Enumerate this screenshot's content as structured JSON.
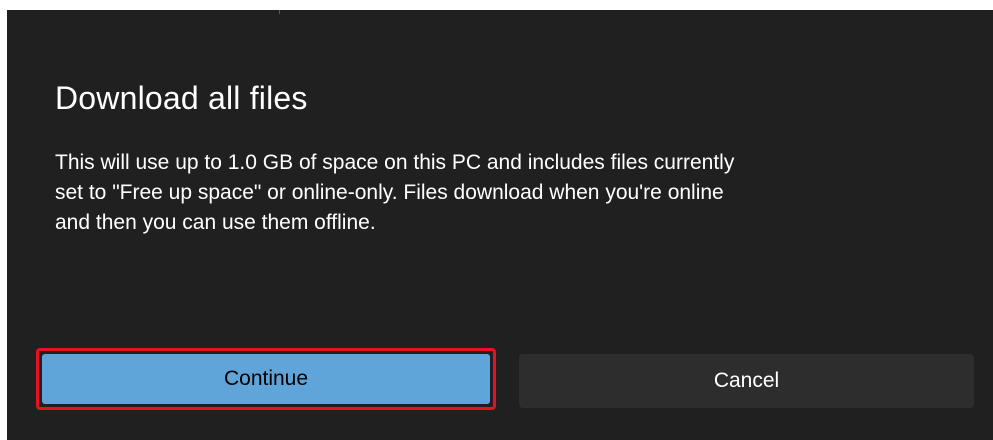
{
  "dialog": {
    "title": "Download all files",
    "body_lines": [
      "This will use up to 1.0 GB of space on this PC and includes files currently",
      "set to \"Free up space\" or online-only. Files download when you're online",
      "and then you can use them offline."
    ],
    "continue_label": "Continue",
    "cancel_label": "Cancel"
  },
  "colors": {
    "dialog_background": "#202020",
    "primary_button": "#60a5d9",
    "secondary_button": "#2d2d2d",
    "highlight_outline": "#e81123"
  }
}
